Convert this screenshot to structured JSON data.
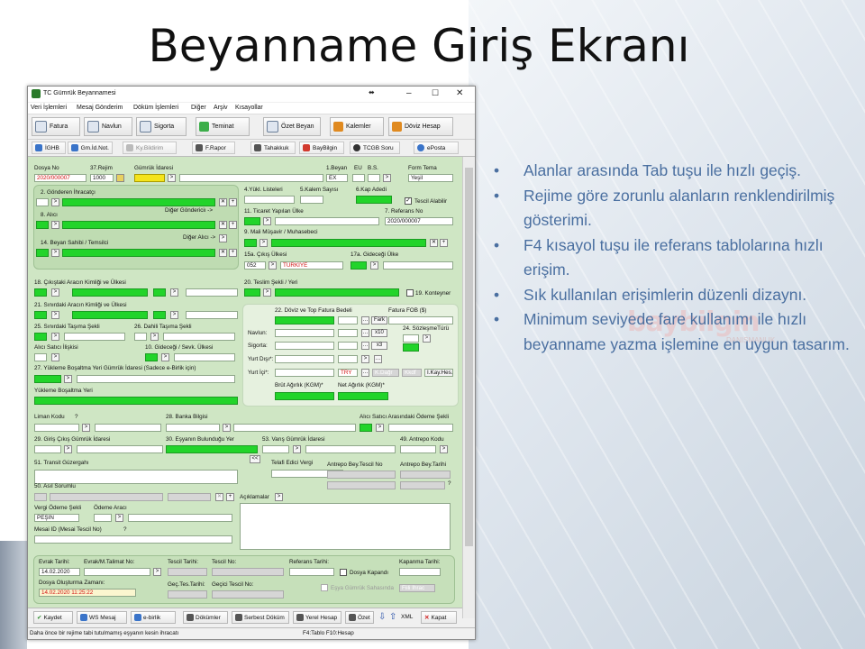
{
  "slide": {
    "title": "Beyanname Giriş Ekranı",
    "bullets": [
      "Alanlar arasında Tab tuşu ile hızlı geçiş.",
      "Rejime göre zorunlu alanların renklendirilmiş gösterimi.",
      "F4 kısayol tuşu ile referans tablolarına hızlı erişim.",
      "Sık kullanılan erişimlerin düzenli dizaynı.",
      "Minimum seviyede fare kullanımı ile hızlı beyanname yazma işlemine en uygun tasarım."
    ],
    "logo": "baybilgin",
    "logo_sub": "DANIŞMANLIK"
  },
  "window": {
    "title": "TC Gümrük Beyannamesi",
    "menu": [
      "Veri İşlemleri",
      "Mesaj Gönderim",
      "Döküm İşlemleri",
      "Diğer",
      "Arşiv",
      "Kısayollar"
    ],
    "toolbar1": [
      "Fatura",
      "Navlun",
      "Sigorta",
      "Teminat",
      "Özet Beyan",
      "Kalemler",
      "Döviz Hesap"
    ],
    "toolbar2": [
      "İGHB",
      "Gm.İd.Not.",
      "Ky.Bildirim",
      "F.Rapor",
      "Tahakkuk",
      "BayBilgin",
      "TCGB Soru",
      "ePosta"
    ]
  },
  "form": {
    "labels": {
      "dosya_no": "Dosya No",
      "rejim": "37.Rejim",
      "gumruk_idaresi": "Gümrük İdaresi",
      "beyan1": "1.Beyan",
      "eu": "EU",
      "bs": "B.S.",
      "form_tema": "Form Tema",
      "gonderen": "2. Gönderen İhracatçı",
      "alici": "8. Alıcı",
      "diger_gonderici": "Diğer Göndericiı ->",
      "beyan_sahibi": "14. Beyan Sahibi / Temsilci",
      "diger_alici": "Diğer Alıcı ->",
      "yukl_listeleri": "4.Yükl. Listeleri",
      "kalem_sayisi": "5.Kalem Sayısı",
      "kap_adedi": "6.Kap Adedi",
      "tescil_alabilir": "Tescil Alabilir",
      "ticaret_ulke": "11. Ticaret Yapılan Ülke",
      "referans_no": "7. Referans No",
      "mali_musavir": "9. Mali Müşavir / Muhasebeci",
      "cikis_ulkesi": "15a. Çıkış Ülkesi",
      "gidecegi_ulke": "17a. Gideceği Ülke",
      "cikistaki_arac": "18. Çıkıştaki Aracın Kimliği ve Ülkesi",
      "teslim_sekli": "20. Teslim Şekli / Yeri",
      "konteyner": "19. Konteyner",
      "sinirdaki_arac": "21. Sınırdaki Aracın Kimliği ve Ülkesi",
      "doviz_fatura": "22. Döviz ve Top Fatura Bedeli",
      "fatura_fob": "Fatura FOB ($)",
      "fark": "Fark",
      "sinir_tasima": "25. Sınırdaki Taşıma Şekli",
      "dahili_tasima": "26. Dahili Taşıma Şekli",
      "navlun": "Navlun:",
      "sozlesme_turu": "24. SözleşmeTürü",
      "sigorta": "Sigorta:",
      "alici_satici": "Alıcı Satıcı İlişkisi",
      "gidecegi_sevk": "10. Gideceği / Sevk. Ülkesi",
      "yurt_disi": "Yurt Dışı*:",
      "yukleme_yeri_idare": "27. Yükleme Boşaltma Yeri Gümrük İdaresi  (Sadece e-Birlik için)",
      "yurt_ici": "Yurt İçi*:",
      "try": "TRY",
      "kdagr": "K.Dağr",
      "kkdf": "Kkdf",
      "ikayhes": "I.Kay.Hes.",
      "yukleme_yeri": "Yükleme Boşaltma Yeri",
      "brut": "Brüt Ağırlık (KGM)*",
      "net": "Net Ağırlık (KGM)*",
      "liman_kodu": "Liman Kodu",
      "q": "?",
      "banka": "28. Banka Bilgisi",
      "alici_satici_odeme": "Alıcı Satıcı Arasındaki Ödeme Şekli",
      "giris_cikis": "29. Giriş Çıkış Gümrük İdaresi",
      "esya_yer": "30. Eşyanın Bulunduğu Yer",
      "varis_idare": "53. Varış Gümrük İdaresi",
      "antrepo_kodu": "49. Antrepo Kodu",
      "transit": "51. Transit Güzergahı",
      "telafi": "Telafi Edici Vergi",
      "antrepo_tescil": "Antrepo Bey.Tescil No",
      "antrepo_tarih": "Antrepo Bey.Tarihi",
      "asil_sorumlu": "50. Asıl Sorumlu",
      "aciklamalar": "Açıklamalar",
      "vergi_odeme": "Vergi Ödeme Şekli",
      "odeme_araci": "Ödeme Aracı",
      "mesai_id": "Mesai ID (Mesai Tescil No)",
      "evrak_tarihi": "Evrak Tarihi:",
      "evrak_talimat": "Evrak/M.Talimat No:",
      "tescil_tarihi": "Tescil Tarihi:",
      "tescil_no": "Tescil No:",
      "referans_tarihi": "Referans Tarihi:",
      "kapanma_tarihi": "Kapanma Tarihi:",
      "dosya_kapandi": "Dosya Kapandı",
      "dosya_olusturma": "Dosya Oluşturma Zamanı:",
      "gec_tes": "Geç.Tes.Tarihi:",
      "gecici_tescil": "Geçici Tescil No:",
      "esya_gumruk": "Eşya Gümrük Sahasında",
      "fiili_ihrac": "Fiili İhrac"
    },
    "values": {
      "dosya_no": "2020/000007",
      "rejim": "1000",
      "beyan1": "EX",
      "form_tema": "Yeşil",
      "referans_no": "2020/000007",
      "cikis_kod": "052",
      "cikis_ulke": "TÜRKİYE",
      "vergi_odeme": "PEŞİN",
      "evrak_tarihi": "14.02.2020",
      "dosya_olusturma": "14.02.2020 11:25:22",
      "x10": "x10",
      "x3": "x3"
    }
  },
  "bottom_buttons": [
    "Kaydet",
    "WS Mesaj",
    "e-birlik",
    "Dökümler",
    "Serbest Döküm",
    "Yerel Hesap",
    "Özet",
    "XML",
    "Kapat"
  ],
  "status": {
    "left": "Daha önce bir rejime tabi tutulmamış eşyanın kesin ihracatı",
    "right": "F4:Tablo F10:Hesap"
  }
}
